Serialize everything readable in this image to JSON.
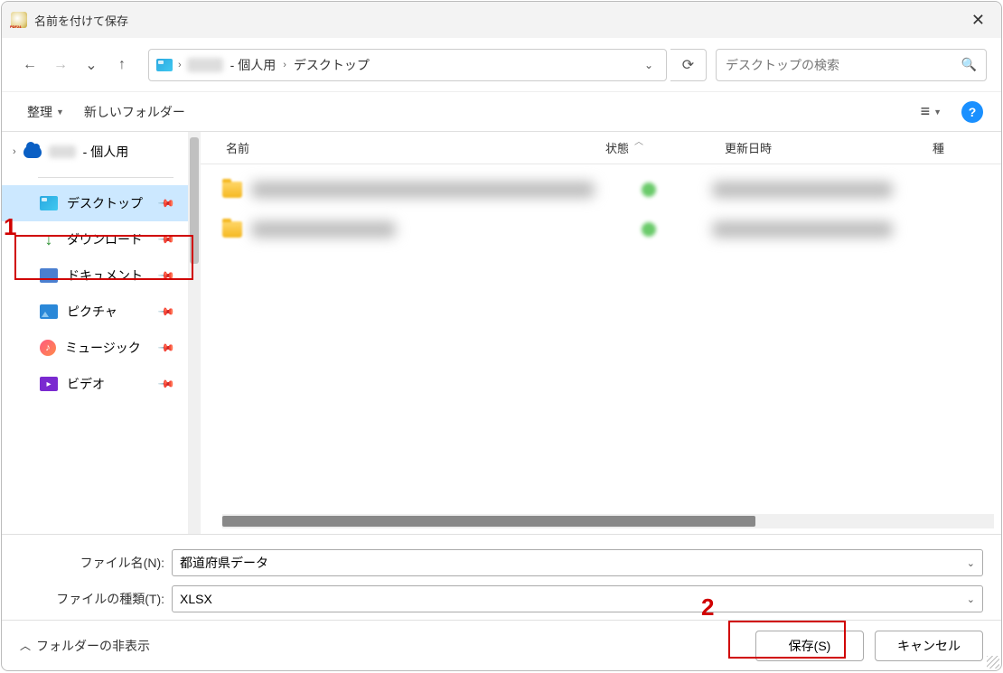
{
  "titlebar": {
    "title": "名前を付けて保存"
  },
  "nav": {
    "back": "←",
    "forward": "→",
    "recent": "⌄",
    "up": "↑"
  },
  "address": {
    "seg_personal_suffix": " - 個人用",
    "seg_desktop": "デスクトップ",
    "sep": "›"
  },
  "search": {
    "placeholder": "デスクトップの検索"
  },
  "toolbar": {
    "organize": "整理",
    "new_folder": "新しいフォルダー"
  },
  "tree": {
    "root_suffix": " - 個人用",
    "items": [
      {
        "label": "デスクトップ"
      },
      {
        "label": "ダウンロード"
      },
      {
        "label": "ドキュメント"
      },
      {
        "label": "ピクチャ"
      },
      {
        "label": "ミュージック"
      },
      {
        "label": "ビデオ"
      }
    ]
  },
  "columns": {
    "name": "名前",
    "status": "状態",
    "date": "更新日時",
    "type": "種"
  },
  "form": {
    "filename_label": "ファイル名(N):",
    "filename_value": "都道府県データ",
    "filetype_label": "ファイルの種類(T):",
    "filetype_value": "XLSX"
  },
  "footer": {
    "hide_folders": "フォルダーの非表示",
    "save": "保存(S)",
    "cancel": "キャンセル"
  },
  "annotations": {
    "one": "1",
    "two": "2"
  }
}
